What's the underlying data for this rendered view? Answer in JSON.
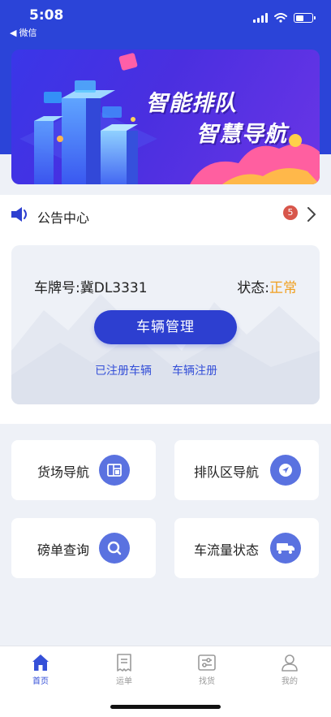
{
  "status_bar": {
    "time": "5:08",
    "back_app": "微信"
  },
  "banner": {
    "title_line1": "智能排队",
    "title_line2": "智慧导航"
  },
  "notice": {
    "title": "公告中心",
    "badge_count": "5"
  },
  "vehicle": {
    "plate_label": "车牌号:",
    "plate": "冀DL3331",
    "status_label": "状态:",
    "status_value": "正常",
    "manage_button": "车辆管理",
    "registered_link": "已注册车辆",
    "register_link": "车辆注册"
  },
  "tiles": [
    {
      "label": "货场导航",
      "icon": "yard-icon"
    },
    {
      "label": "排队区导航",
      "icon": "navigation-arrow-icon"
    },
    {
      "label": "磅单查询",
      "icon": "search-icon"
    },
    {
      "label": "车流量状态",
      "icon": "truck-icon"
    }
  ],
  "tabbar": [
    {
      "label": "首页",
      "icon": "home-icon",
      "active": true
    },
    {
      "label": "运单",
      "icon": "waybill-icon",
      "active": false
    },
    {
      "label": "找货",
      "icon": "find-goods-icon",
      "active": false
    },
    {
      "label": "我的",
      "icon": "profile-icon",
      "active": false
    }
  ],
  "colors": {
    "brand_blue": "#2b44d8",
    "button_blue": "#2d3fd0",
    "tile_icon_bg": "#5a72e0",
    "status_ok": "#f0a020",
    "badge_red": "#d8564b"
  }
}
